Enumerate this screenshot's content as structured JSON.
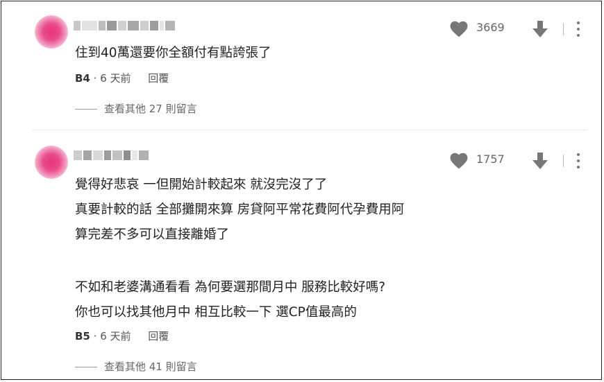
{
  "comments": [
    {
      "floor": "B4",
      "time": "6 天前",
      "reply_label": "回覆",
      "likes": "3669",
      "lines": [
        "住到40萬還要你全額付有點誇張了"
      ],
      "more_replies": "查看其他 27 則留言"
    },
    {
      "floor": "B5",
      "time": "6 天前",
      "reply_label": "回覆",
      "likes": "1757",
      "lines": [
        "覺得好悲哀 一但開始計較起來 就沒完沒了了",
        "真要計較的話 全部攤開來算 房貸阿平常花費阿代孕費用阿",
        "算完差不多可以直接離婚了",
        "",
        "不如和老婆溝通看看 為何要選那間月中 服務比較好嗎?",
        "你也可以找其他月中 相互比較一下 選CP值最高的"
      ],
      "more_replies": "查看其他 41 則留言"
    }
  ],
  "icons": {
    "avatar": "blurred-avatar",
    "like": "heart-icon",
    "dislike": "down-arrow-icon",
    "menu": "kebab-menu-icon"
  },
  "colors": {
    "avatar": "#e8327a",
    "icon": "#777777",
    "text": "#222222",
    "meta": "#555555"
  }
}
